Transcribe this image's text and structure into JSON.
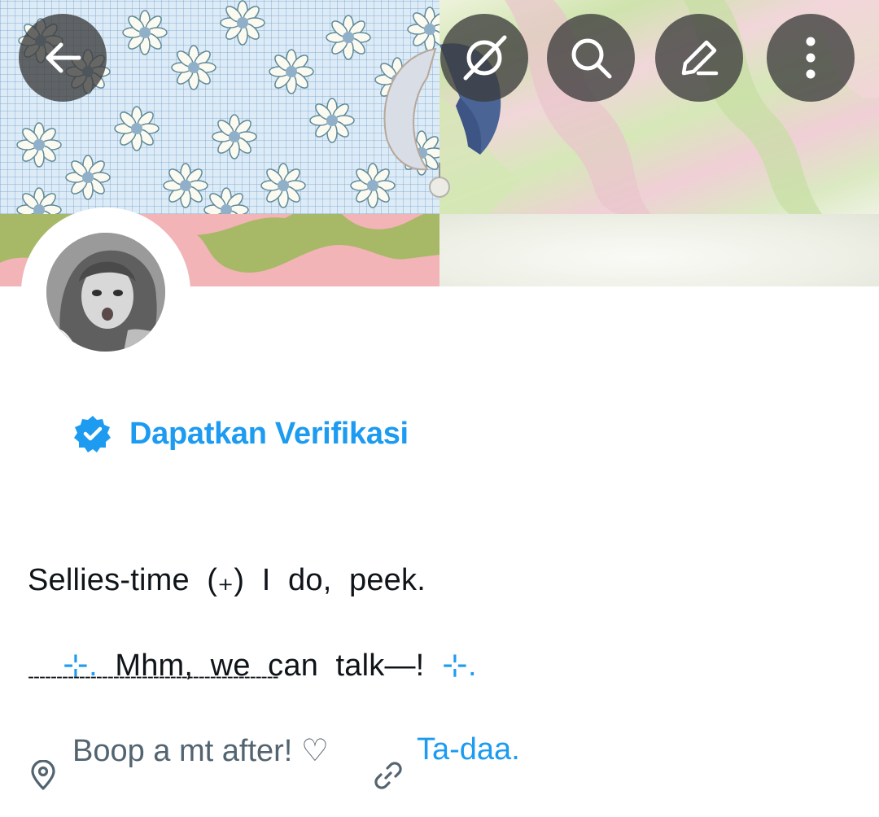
{
  "header": {
    "buttons": [
      {
        "name": "back",
        "icon": "arrow-left-icon"
      },
      {
        "name": "grok",
        "icon": "grok-icon"
      },
      {
        "name": "search",
        "icon": "search-icon"
      },
      {
        "name": "edit",
        "icon": "pencil-icon"
      },
      {
        "name": "more",
        "icon": "more-vertical-icon"
      }
    ]
  },
  "verification": {
    "label": "Dapatkan Verifikasi",
    "icon": "verified-badge-icon",
    "color": "#1d9bf0"
  },
  "bio": {
    "line1": "Sellies-time  (₊)  I  do,  peek.",
    "line2_sparkle_left": "⊹.",
    "line2_text": "  Mhm,  we  can  talk—!  ",
    "line2_sparkle_right": "⊹.",
    "divider": "--------------------------------------------"
  },
  "meta": {
    "location": "Boop a mt after! ♡",
    "location_icon": "location-pin-icon",
    "link": "Ta-daa.",
    "link_icon": "link-icon"
  },
  "colors": {
    "accent": "#1d9bf0",
    "text": "#0f1419",
    "muted": "#536471"
  }
}
